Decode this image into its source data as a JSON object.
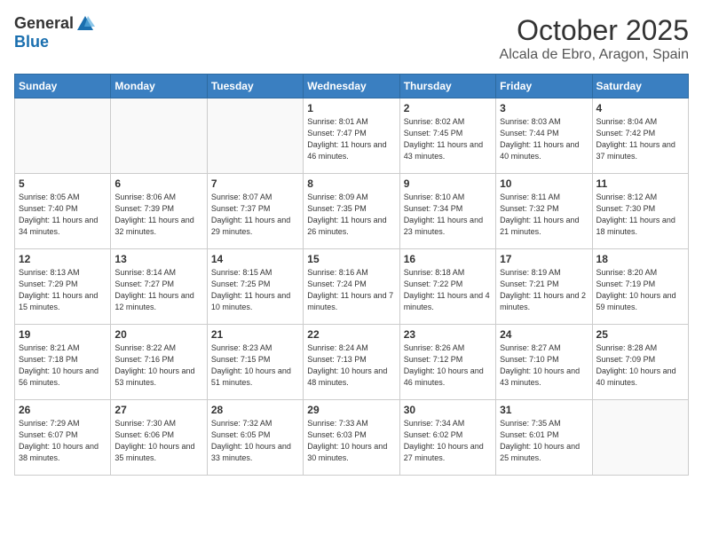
{
  "logo": {
    "general": "General",
    "blue": "Blue"
  },
  "title": "October 2025",
  "location": "Alcala de Ebro, Aragon, Spain",
  "weekdays": [
    "Sunday",
    "Monday",
    "Tuesday",
    "Wednesday",
    "Thursday",
    "Friday",
    "Saturday"
  ],
  "weeks": [
    [
      {
        "day": "",
        "sunrise": "",
        "sunset": "",
        "daylight": ""
      },
      {
        "day": "",
        "sunrise": "",
        "sunset": "",
        "daylight": ""
      },
      {
        "day": "",
        "sunrise": "",
        "sunset": "",
        "daylight": ""
      },
      {
        "day": "1",
        "sunrise": "8:01 AM",
        "sunset": "7:47 PM",
        "daylight": "11 hours and 46 minutes."
      },
      {
        "day": "2",
        "sunrise": "8:02 AM",
        "sunset": "7:45 PM",
        "daylight": "11 hours and 43 minutes."
      },
      {
        "day": "3",
        "sunrise": "8:03 AM",
        "sunset": "7:44 PM",
        "daylight": "11 hours and 40 minutes."
      },
      {
        "day": "4",
        "sunrise": "8:04 AM",
        "sunset": "7:42 PM",
        "daylight": "11 hours and 37 minutes."
      }
    ],
    [
      {
        "day": "5",
        "sunrise": "8:05 AM",
        "sunset": "7:40 PM",
        "daylight": "11 hours and 34 minutes."
      },
      {
        "day": "6",
        "sunrise": "8:06 AM",
        "sunset": "7:39 PM",
        "daylight": "11 hours and 32 minutes."
      },
      {
        "day": "7",
        "sunrise": "8:07 AM",
        "sunset": "7:37 PM",
        "daylight": "11 hours and 29 minutes."
      },
      {
        "day": "8",
        "sunrise": "8:09 AM",
        "sunset": "7:35 PM",
        "daylight": "11 hours and 26 minutes."
      },
      {
        "day": "9",
        "sunrise": "8:10 AM",
        "sunset": "7:34 PM",
        "daylight": "11 hours and 23 minutes."
      },
      {
        "day": "10",
        "sunrise": "8:11 AM",
        "sunset": "7:32 PM",
        "daylight": "11 hours and 21 minutes."
      },
      {
        "day": "11",
        "sunrise": "8:12 AM",
        "sunset": "7:30 PM",
        "daylight": "11 hours and 18 minutes."
      }
    ],
    [
      {
        "day": "12",
        "sunrise": "8:13 AM",
        "sunset": "7:29 PM",
        "daylight": "11 hours and 15 minutes."
      },
      {
        "day": "13",
        "sunrise": "8:14 AM",
        "sunset": "7:27 PM",
        "daylight": "11 hours and 12 minutes."
      },
      {
        "day": "14",
        "sunrise": "8:15 AM",
        "sunset": "7:25 PM",
        "daylight": "11 hours and 10 minutes."
      },
      {
        "day": "15",
        "sunrise": "8:16 AM",
        "sunset": "7:24 PM",
        "daylight": "11 hours and 7 minutes."
      },
      {
        "day": "16",
        "sunrise": "8:18 AM",
        "sunset": "7:22 PM",
        "daylight": "11 hours and 4 minutes."
      },
      {
        "day": "17",
        "sunrise": "8:19 AM",
        "sunset": "7:21 PM",
        "daylight": "11 hours and 2 minutes."
      },
      {
        "day": "18",
        "sunrise": "8:20 AM",
        "sunset": "7:19 PM",
        "daylight": "10 hours and 59 minutes."
      }
    ],
    [
      {
        "day": "19",
        "sunrise": "8:21 AM",
        "sunset": "7:18 PM",
        "daylight": "10 hours and 56 minutes."
      },
      {
        "day": "20",
        "sunrise": "8:22 AM",
        "sunset": "7:16 PM",
        "daylight": "10 hours and 53 minutes."
      },
      {
        "day": "21",
        "sunrise": "8:23 AM",
        "sunset": "7:15 PM",
        "daylight": "10 hours and 51 minutes."
      },
      {
        "day": "22",
        "sunrise": "8:24 AM",
        "sunset": "7:13 PM",
        "daylight": "10 hours and 48 minutes."
      },
      {
        "day": "23",
        "sunrise": "8:26 AM",
        "sunset": "7:12 PM",
        "daylight": "10 hours and 46 minutes."
      },
      {
        "day": "24",
        "sunrise": "8:27 AM",
        "sunset": "7:10 PM",
        "daylight": "10 hours and 43 minutes."
      },
      {
        "day": "25",
        "sunrise": "8:28 AM",
        "sunset": "7:09 PM",
        "daylight": "10 hours and 40 minutes."
      }
    ],
    [
      {
        "day": "26",
        "sunrise": "7:29 AM",
        "sunset": "6:07 PM",
        "daylight": "10 hours and 38 minutes."
      },
      {
        "day": "27",
        "sunrise": "7:30 AM",
        "sunset": "6:06 PM",
        "daylight": "10 hours and 35 minutes."
      },
      {
        "day": "28",
        "sunrise": "7:32 AM",
        "sunset": "6:05 PM",
        "daylight": "10 hours and 33 minutes."
      },
      {
        "day": "29",
        "sunrise": "7:33 AM",
        "sunset": "6:03 PM",
        "daylight": "10 hours and 30 minutes."
      },
      {
        "day": "30",
        "sunrise": "7:34 AM",
        "sunset": "6:02 PM",
        "daylight": "10 hours and 27 minutes."
      },
      {
        "day": "31",
        "sunrise": "7:35 AM",
        "sunset": "6:01 PM",
        "daylight": "10 hours and 25 minutes."
      },
      {
        "day": "",
        "sunrise": "",
        "sunset": "",
        "daylight": ""
      }
    ]
  ]
}
